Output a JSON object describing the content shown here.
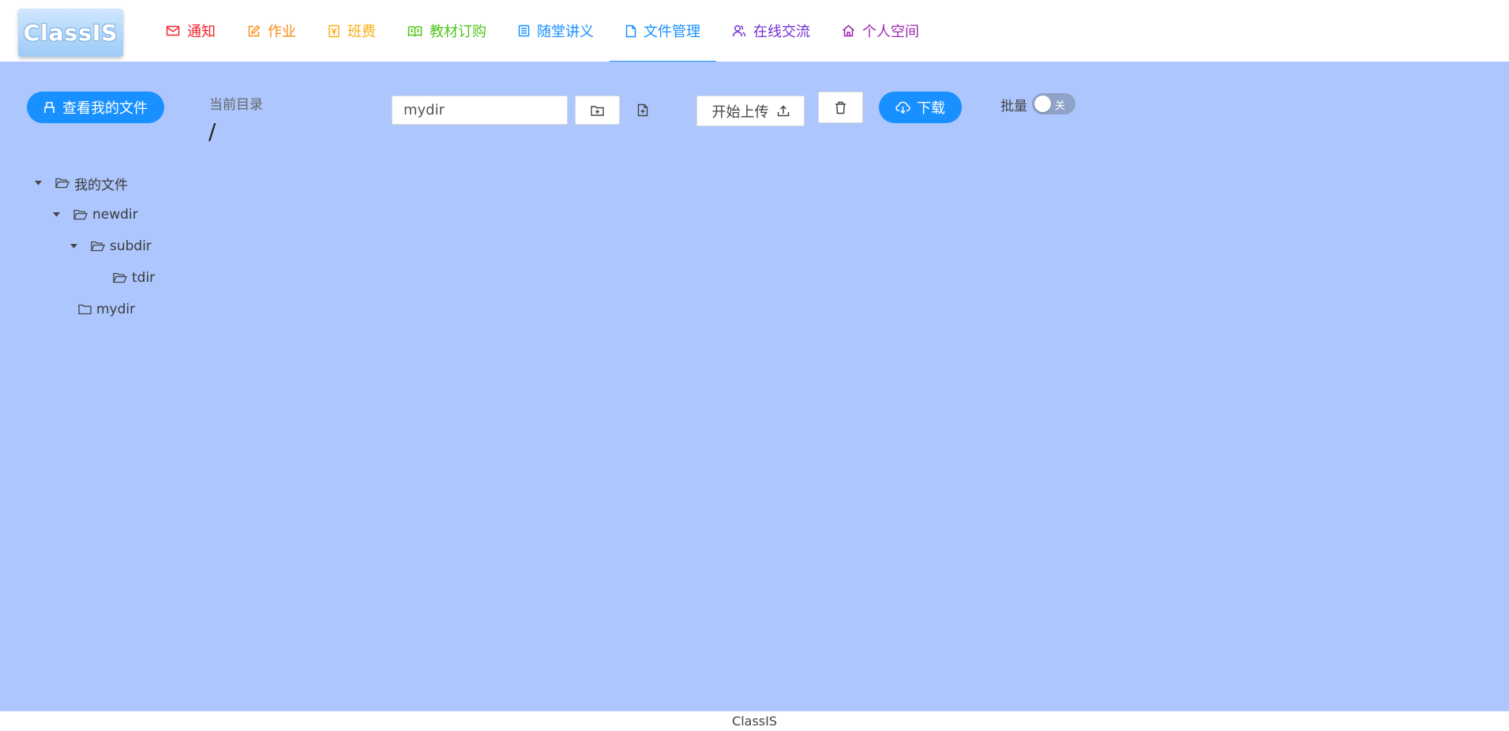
{
  "logo": {
    "text": "ClassIS"
  },
  "nav": [
    {
      "label": "通知",
      "icon": "mail-icon",
      "color": "#f5222d"
    },
    {
      "label": "作业",
      "icon": "edit-icon",
      "color": "#fa8c16"
    },
    {
      "label": "班费",
      "icon": "money-icon",
      "color": "#faad14"
    },
    {
      "label": "教材订购",
      "icon": "book-icon",
      "color": "#52c41a"
    },
    {
      "label": "随堂讲义",
      "icon": "list-icon",
      "color": "#1890ff"
    },
    {
      "label": "文件管理",
      "icon": "file-icon",
      "color": "#1890ff",
      "active": true
    },
    {
      "label": "在线交流",
      "icon": "users-icon",
      "color": "#722ed1"
    },
    {
      "label": "个人空间",
      "icon": "home-icon",
      "color": "#9c27b0"
    }
  ],
  "toolbar": {
    "my_files_label": "查看我的文件",
    "current_dir_label": "当前目录",
    "current_dir_value": "/",
    "name_input_value": "mydir",
    "upload_label": "开始上传",
    "download_label": "下载",
    "batch_label": "批量",
    "batch_switch_text": "关"
  },
  "tree": {
    "root": "我的文件",
    "n1": "newdir",
    "n2": "subdir",
    "n3": "tdir",
    "n4": "mydir"
  },
  "footer": {
    "text": "ClassIS"
  },
  "colors": {
    "accent": "#1890ff",
    "main_bg": "#adc6fd"
  }
}
